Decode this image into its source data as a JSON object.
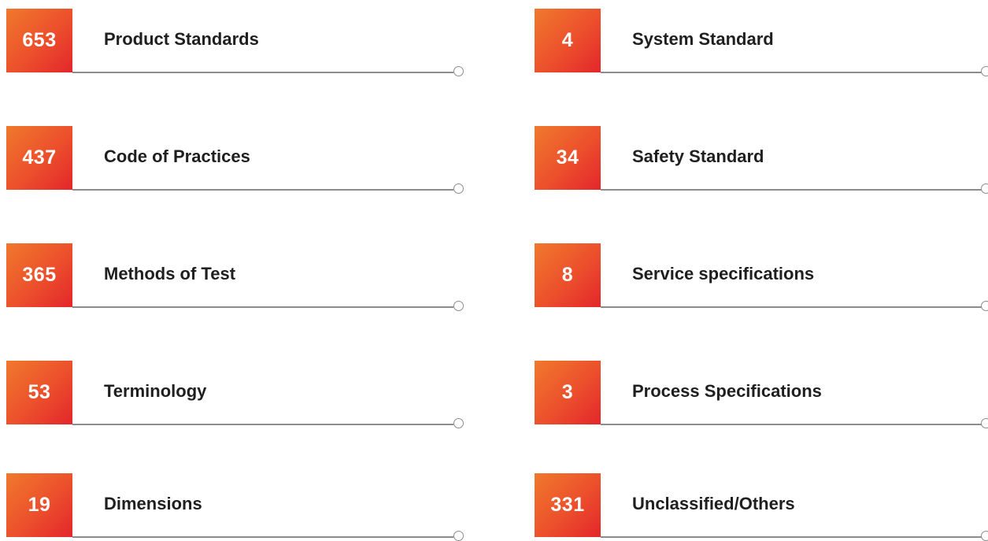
{
  "colors": {
    "badge_gradient_start": "#f0792c",
    "badge_gradient_end": "#e3262b",
    "rule": "#8c8c8c",
    "label_text": "#1f1f1f"
  },
  "categories": [
    {
      "count": "653",
      "label": "Product Standards"
    },
    {
      "count": "437",
      "label": "Code of Practices"
    },
    {
      "count": "365",
      "label": "Methods of Test"
    },
    {
      "count": "53",
      "label": "Terminology"
    },
    {
      "count": "19",
      "label": "Dimensions"
    },
    {
      "count": "4",
      "label": "System Standard"
    },
    {
      "count": "34",
      "label": "Safety Standard"
    },
    {
      "count": "8",
      "label": "Service specifications"
    },
    {
      "count": "3",
      "label": "Process Specifications"
    },
    {
      "count": "331",
      "label": "Unclassified/Others"
    }
  ]
}
